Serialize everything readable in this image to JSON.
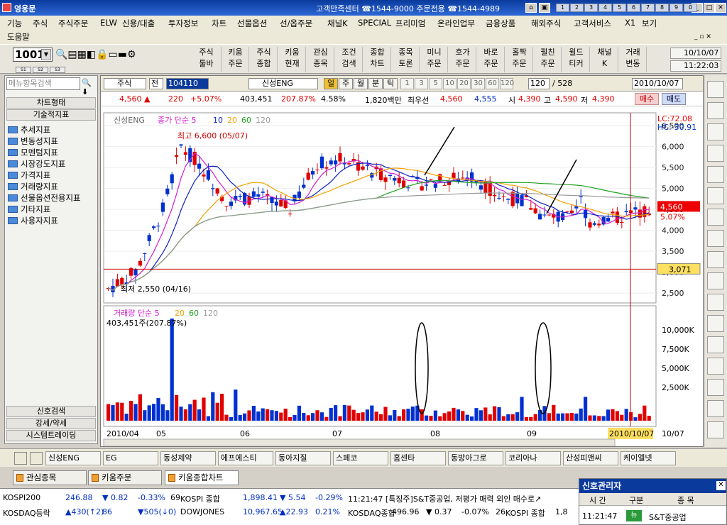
{
  "window": {
    "title": "영웅문",
    "center": "고객만족센터 ☎1544-9000 주문전용 ☎1544-4989",
    "numbtns": [
      "1",
      "2",
      "3",
      "4",
      "5",
      "6",
      "7",
      "8",
      "9",
      "0"
    ]
  },
  "menu": {
    "row1": [
      "기능",
      "주식",
      "주식주문",
      "ELW",
      "신용/대출",
      "투자정보",
      "차트",
      "선물옵션",
      "선/옵주문",
      "채널K",
      "SPECIAL",
      "프리미엄",
      "온라인업무",
      "금융상품",
      "해외주식",
      "고객서비스",
      "X1",
      "보기"
    ],
    "row2": [
      "도움말"
    ]
  },
  "toolbar": {
    "screen_no": "1001",
    "buttons": [
      "주식\n툴바",
      "키움\n주문",
      "주식\n종합",
      "키움\n현재",
      "관심\n종목",
      "조건\n검색",
      "종합\n차트",
      "종목\n토론",
      "미니\n주문",
      "호가\n주문",
      "바로\n주문",
      "홀짝\n주문",
      "펄친\n주문",
      "윌드\n티커",
      "채널\nK",
      "거래\n변동"
    ],
    "small": [
      "S1",
      "S2",
      "S3"
    ],
    "date": "10/10/07",
    "time": "11:22:03"
  },
  "left": {
    "search_placeholder": "메뉴항목검색",
    "chart_type": "차트형태",
    "tech": "기술적지표",
    "items": [
      "추세지표",
      "변동성지표",
      "모멘텀지표",
      "시장강도지표",
      "가격지표",
      "거래량지표",
      "선물옵션전용지표",
      "기타지표",
      "사용자지표"
    ],
    "bottom": [
      "신호검색",
      "강세/약세",
      "시스템트레이딩"
    ]
  },
  "chart": {
    "market": "주식",
    "period": "전",
    "code": "104110",
    "name": "신성ENG",
    "tabs": [
      "일",
      "주",
      "월",
      "분",
      "틱"
    ],
    "mins": [
      "1",
      "3",
      "5",
      "10",
      "20",
      "30",
      "60",
      "120"
    ],
    "count": "120",
    "total": "/ 528",
    "date": "2010/10/07",
    "buy": "매수",
    "sell": "매도",
    "info": {
      "price": "4,560 ▲",
      "chg": "220",
      "pct": "+5.07%",
      "vol": "403,451",
      "vol_pct": "207.87%",
      "turn": "4.58%",
      "amt": "1,820백만",
      "bid_l": "최우선",
      "bid": "4,560",
      "ask": "4,555",
      "o_l": "시",
      "o": "4,390",
      "h_l": "고",
      "h": "4,590",
      "l_l": "저",
      "l": "4,390"
    },
    "legend": {
      "name": "신성ENG",
      "ma": "종가 단순 5",
      "p": [
        "10",
        "20",
        "60",
        "120"
      ]
    },
    "lc": "LC:72.08",
    "hc": "HC:-30.91",
    "hi": "최고 6,600 (05/07)",
    "lo": "최저 2,550 (04/16)",
    "yticks": [
      "6,500",
      "6,000",
      "5,500",
      "5,000",
      "4,500",
      "4,000",
      "3,500",
      "3,000",
      "2,500"
    ],
    "cur_price": "4,560",
    "cur_pct": "5.07%",
    "cross": "3,071",
    "vol_legend": "거래량 단순 5",
    "vol_p": [
      "20",
      "60",
      "120"
    ],
    "vol_value": "403,451주(207.87%)",
    "vticks": [
      "10,000K",
      "7,500K",
      "5,000K",
      "2,500K"
    ],
    "xlabels": [
      "2010/04",
      "05",
      "06",
      "07",
      "08",
      "09"
    ],
    "xdate": "2010/10/07",
    "xend": "10/07"
  },
  "chart_data": {
    "type": "candlestick",
    "title": "신성ENG",
    "x_range": [
      "2010/04/16",
      "2010/10/07"
    ],
    "ylim": [
      2500,
      6600
    ],
    "high": {
      "value": 6600,
      "date": "05/07"
    },
    "low": {
      "value": 2550,
      "date": "04/16"
    },
    "last": {
      "close": 4560,
      "open": 4390,
      "high": 4590,
      "low": 4390,
      "volume": 403451
    }
  },
  "stocks": [
    "신성ENG",
    "EG",
    "동성제약",
    "에프에스티",
    "동아지질",
    "스페코",
    "홈센타",
    "동방아그로",
    "코리아나",
    "산성피앤씨",
    "케이엘넷"
  ],
  "wintabs": [
    "관심종목",
    "키움주문",
    "키움종합차트"
  ],
  "ticker": {
    "r1": [
      {
        "n": "KOSPI200",
        "v": "246.88",
        "c": "▼ 0.82",
        "p": "-0.33%",
        "x": "69"
      },
      {
        "n": "KOSPI 종합",
        "v": "1,898.41",
        "c": "▼ 5.54",
        "p": "-0.29%"
      }
    ],
    "r2": [
      {
        "n": "KOSDAQ등락",
        "v": "▲430(↑2)",
        "c": "86",
        "p": "▼505(↓0)"
      },
      {
        "n": "DOWJONES",
        "v": "10,967.65",
        "c": "▲22.93",
        "p": "0.21%"
      }
    ],
    "news": "11:21:47 [특징주]S&T중공업, 저평가 매력 외인 매수로↗",
    "r3": {
      "n": "KOSDAQ종합",
      "v": "496.96",
      "c": "▼ 0.37",
      "p": "-0.07%",
      "x": "26",
      "k": "KOSPI 종합",
      "kv": "1,8"
    }
  },
  "signal": {
    "title": "신호관리자",
    "cols": [
      "시 간",
      "구분",
      "종 목"
    ],
    "row": {
      "time": "11:21:47",
      "type": "뉴",
      "name": "S&T중공업"
    }
  },
  "colors": {
    "title": "#0a3a9c",
    "up": "#d00000",
    "down": "#0030c0"
  }
}
